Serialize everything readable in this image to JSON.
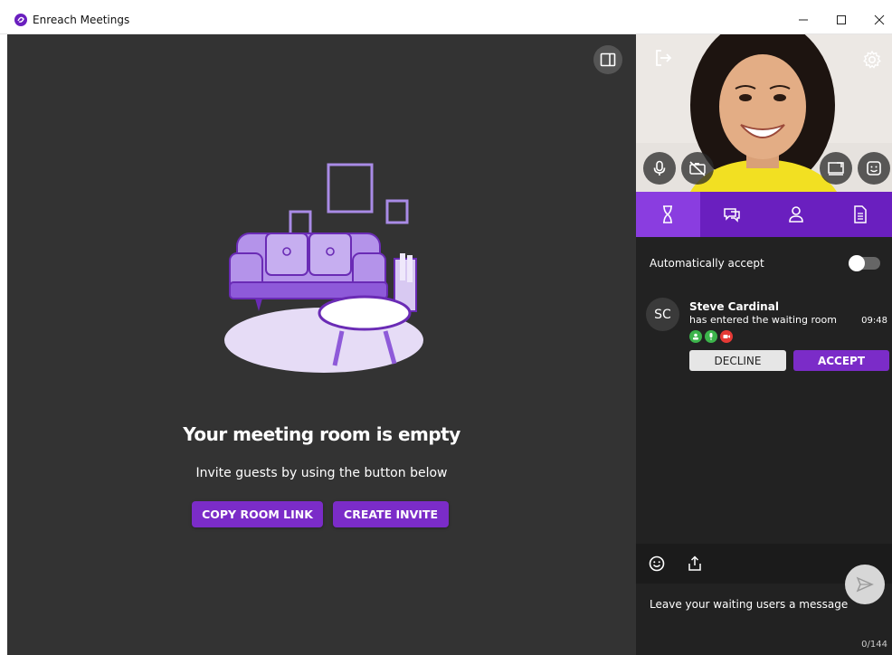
{
  "window": {
    "title": "Enreach Meetings",
    "controls": {
      "minimize": "–",
      "maximize": "☐",
      "close": "✕"
    }
  },
  "stage": {
    "empty_title": "Your meeting room is empty",
    "empty_subtitle": "Invite guests by using the button below",
    "copy_room_link_label": "COPY ROOM LINK",
    "create_invite_label": "CREATE INVITE"
  },
  "sidebar": {
    "tabs": [
      {
        "icon": "hourglass-icon",
        "active": true
      },
      {
        "icon": "chat-icon",
        "active": false
      },
      {
        "icon": "person-icon",
        "active": false
      },
      {
        "icon": "document-icon",
        "active": false
      }
    ],
    "auto_accept_label": "Automatically accept",
    "auto_accept_on": false,
    "waiting": [
      {
        "initials": "SC",
        "name": "Steve Cardinal",
        "status": "has entered the waiting room",
        "time": "09:48",
        "decline_label": "DECLINE",
        "accept_label": "ACCEPT"
      }
    ],
    "message_placeholder": "Leave your waiting users a message",
    "counter": "0/144"
  },
  "colors": {
    "accent": "#7b2cc8",
    "tab_bar": "#6a1fbf",
    "stage_bg": "#333333",
    "sidebar_bg": "#222222"
  }
}
